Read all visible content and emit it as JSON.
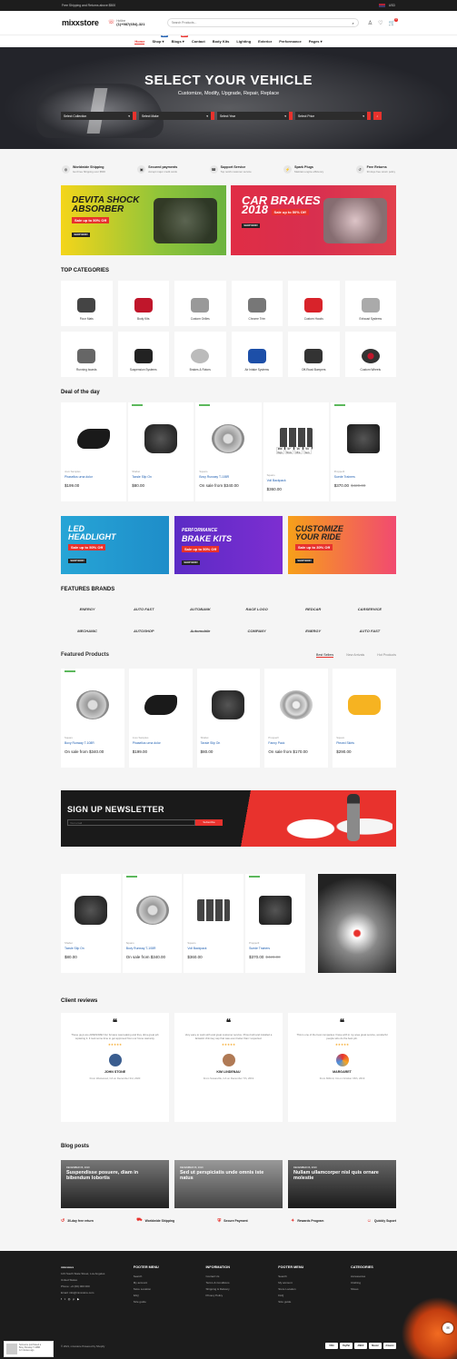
{
  "topbar": {
    "promo": "Free Shipping and Returns above $500",
    "currency": "USD"
  },
  "header": {
    "logo": "mixxstore",
    "phone_label": "Hotline",
    "phone": "(1)+987(654)-321",
    "search_placeholder": "Search Products...",
    "cart_count": "0"
  },
  "nav": {
    "items": [
      "Home",
      "Shop",
      "Blogs",
      "Contact",
      "Body Kits",
      "Lighting",
      "Exterior",
      "Performance",
      "Pages"
    ],
    "shop_tag": "NEW",
    "blogs_tag": "SALE"
  },
  "hero": {
    "title": "SELECT YOUR VEHICLE",
    "subtitle": "Customize, Modify, Upgrade, Repair, Replace",
    "selects": [
      "Select Collection",
      "Select Make",
      "Select Year",
      "Select Price"
    ]
  },
  "features": [
    {
      "title": "Worldwide Shipping",
      "sub": "Get Free Shipping over $500"
    },
    {
      "title": "Secured payments",
      "sub": "Accept major credit cards"
    },
    {
      "title": "Support Service",
      "sub": "Top notch customer service"
    },
    {
      "title": "Spark Plugs",
      "sub": "Maintain engine efficiency"
    },
    {
      "title": "Free Returns",
      "sub": "30 days free return policy"
    }
  ],
  "banners": {
    "b1": {
      "l1": "DEVITA SHOCK",
      "l2": "ABSORBER",
      "sale": "Sale up to 50% Off",
      "shop": "SHOP NOW!"
    },
    "b2": {
      "l1": "CAR BRAKES",
      "l2": "2018",
      "sale": "Sale up to 50% Off",
      "shop": "SHOP NOW!"
    }
  },
  "top_categories": {
    "title": "TOP CATEGORIES",
    "items": [
      "Floor Mats",
      "Body Kits",
      "Custom Grilles",
      "Chrome Trim",
      "Custom Hoods",
      "Exhaust Systems",
      "Running boards",
      "Suspension Systems",
      "Brakes & Rotors",
      "Air Intake Systems",
      "Off-Road Bumpers",
      "Custom Wheels"
    ]
  },
  "deal": {
    "title": "Deal of the day",
    "countdown": [
      "263",
      "07",
      "16",
      "53"
    ],
    "countdown_units": [
      "Days",
      "Hours",
      "Mins",
      "Secs"
    ],
    "products": [
      {
        "vendor": "Jovo Samples",
        "name": "Phasellus urna dolor",
        "price": "$199.00",
        "old": ""
      },
      {
        "vendor": "Shabet",
        "name": "Taxsle Slip On",
        "price": "$80.00",
        "old": ""
      },
      {
        "vendor": "Squaro",
        "name": "Bovy Runway T-108R",
        "price": "On sale from $340.00",
        "old": ""
      },
      {
        "vendor": "Squaro",
        "name": "Voll Backpack",
        "price": "$360.00",
        "old": ""
      },
      {
        "vendor": "Propperll",
        "name": "Suede Trainers",
        "price": "$370.00",
        "old": "$420.00"
      }
    ]
  },
  "banners3": [
    {
      "l1": "LED",
      "l2": "HEADLIGHT",
      "sale": "Sale up to 50% Off",
      "shop": "SHOP NOW!"
    },
    {
      "l1": "PERFORMANCE",
      "l2": "BRAKE KITS",
      "sale": "Sale up to 50% Off",
      "shop": "SHOP NOW!"
    },
    {
      "l1": "CUSTOMIZE",
      "l2": "YOUR RIDE",
      "sale": "Sale up to 30% Off",
      "shop": "SHOP NOW!"
    }
  ],
  "brands": {
    "title": "FEATURES BRANDS",
    "items": [
      "ENERGY",
      "AUTO FAST",
      "AUTOBANK",
      "RACE LOGO",
      "REDCAR",
      "CARSERVICE",
      "MECHANIC",
      "AUTOSHOP",
      "Automobile",
      "COMPANY",
      "ENERGY",
      "AUTO FAST"
    ]
  },
  "featured": {
    "title": "Featured Products",
    "tabs": [
      "Best Sellers",
      "New Arrivals",
      "Hot Products"
    ],
    "products": [
      {
        "vendor": "Squaro",
        "name": "Bovy Runway T-108R",
        "price": "On sale from $340.00",
        "old": ""
      },
      {
        "vendor": "Jovo Samples",
        "name": "Phasellus urna dolor",
        "price": "$199.00",
        "old": ""
      },
      {
        "vendor": "Shabet",
        "name": "Taxsle Slip On",
        "price": "$80.00",
        "old": ""
      },
      {
        "vendor": "Propperll",
        "name": "Fanny Pack",
        "price": "On sale from $170.00",
        "old": ""
      },
      {
        "vendor": "Squaro",
        "name": "Pieced Skirts",
        "price": "$290.00",
        "old": ""
      }
    ]
  },
  "newsletter": {
    "title": "SIGN UP NEWSLETTER",
    "placeholder": "Your email",
    "button": "Subscribe"
  },
  "row4": [
    {
      "vendor": "Shabet",
      "name": "Taxsle Slip On",
      "price": "$80.00",
      "old": ""
    },
    {
      "vendor": "Squaro",
      "name": "Bovy Runway T-108R",
      "price": "On sale from $340.00",
      "old": ""
    },
    {
      "vendor": "Squaro",
      "name": "Voll Backpack",
      "price": "$360.00",
      "old": ""
    },
    {
      "vendor": "Propperll",
      "name": "Suede Trainers",
      "price": "$370.00",
      "old": "$420.00"
    }
  ],
  "reviews": {
    "title": "Client reviews",
    "items": [
      {
        "text": "These guys are AWESOME! Our furnace was leaking and they did a great job replacing it. It took some time to get approved from our home warranty.",
        "name": "JOHN STONE",
        "from": "From Westwood, CA on December 3rd, 2020"
      },
      {
        "text": "Very easy to work with and great customer service. Pinsu built and installed a fantastic chimney cap that was even better than I expected.",
        "name": "KIM LINDENAU",
        "from": "From Susanville, CA on December 7th, 2019"
      },
      {
        "text": "This is one of the best companies I have with in my area great service, wonderful people who do the best job.",
        "name": "MARGARET",
        "from": "From Milford, CA on October 15th, 2019"
      }
    ],
    "stars": "★★★★★"
  },
  "blog": {
    "title": "Blog posts",
    "posts": [
      {
        "date": "DECEMBER 06, 2019",
        "title": "Suspendisse posuere, diam in bibendum lobortis"
      },
      {
        "date": "DECEMBER 06, 2019",
        "title": "Sed ut perspiciatis unde omnis iste natus"
      },
      {
        "date": "DECEMBER 06, 2019",
        "title": "Nullam ullamcorper nisl quis ornare molestie"
      }
    ]
  },
  "services": [
    "30-day free return",
    "Worldwide Shipping",
    "Secure Payment",
    "Rewards Program",
    "Quickly Suport"
  ],
  "footer": {
    "logo": "mixxstore",
    "address": [
      "123 South State Street, Los Angeles",
      "United States",
      "Phone: +0 (00) 000 000",
      "Email: info@mixxstore.com"
    ],
    "cols": [
      {
        "title": "FOOTER MENU",
        "items": [
          "Search",
          "My account",
          "Store Location",
          "FAQ",
          "Size guide"
        ]
      },
      {
        "title": "INFORMATION",
        "items": [
          "Contact Us",
          "Terms & Conditions",
          "Shipping & Delivery",
          "Privacy Policy"
        ]
      },
      {
        "title": "FOOTER MENU",
        "items": [
          "Search",
          "My account",
          "Store Location",
          "FAQ",
          "Size guide"
        ]
      },
      {
        "title": "CATEGORIES",
        "items": [
          "Accessories",
          "Clothing",
          "Shoes"
        ]
      }
    ],
    "copyright": "© 2021, mixxstore Powered by Shopify",
    "payments": [
      "VISA",
      "PayPal",
      "AMEX",
      "Master",
      "Amazon"
    ]
  },
  "popup": {
    "l1": "Someone purchased a",
    "l2": "Bovy Runway T-108R",
    "l3": "12 minutes ago"
  }
}
